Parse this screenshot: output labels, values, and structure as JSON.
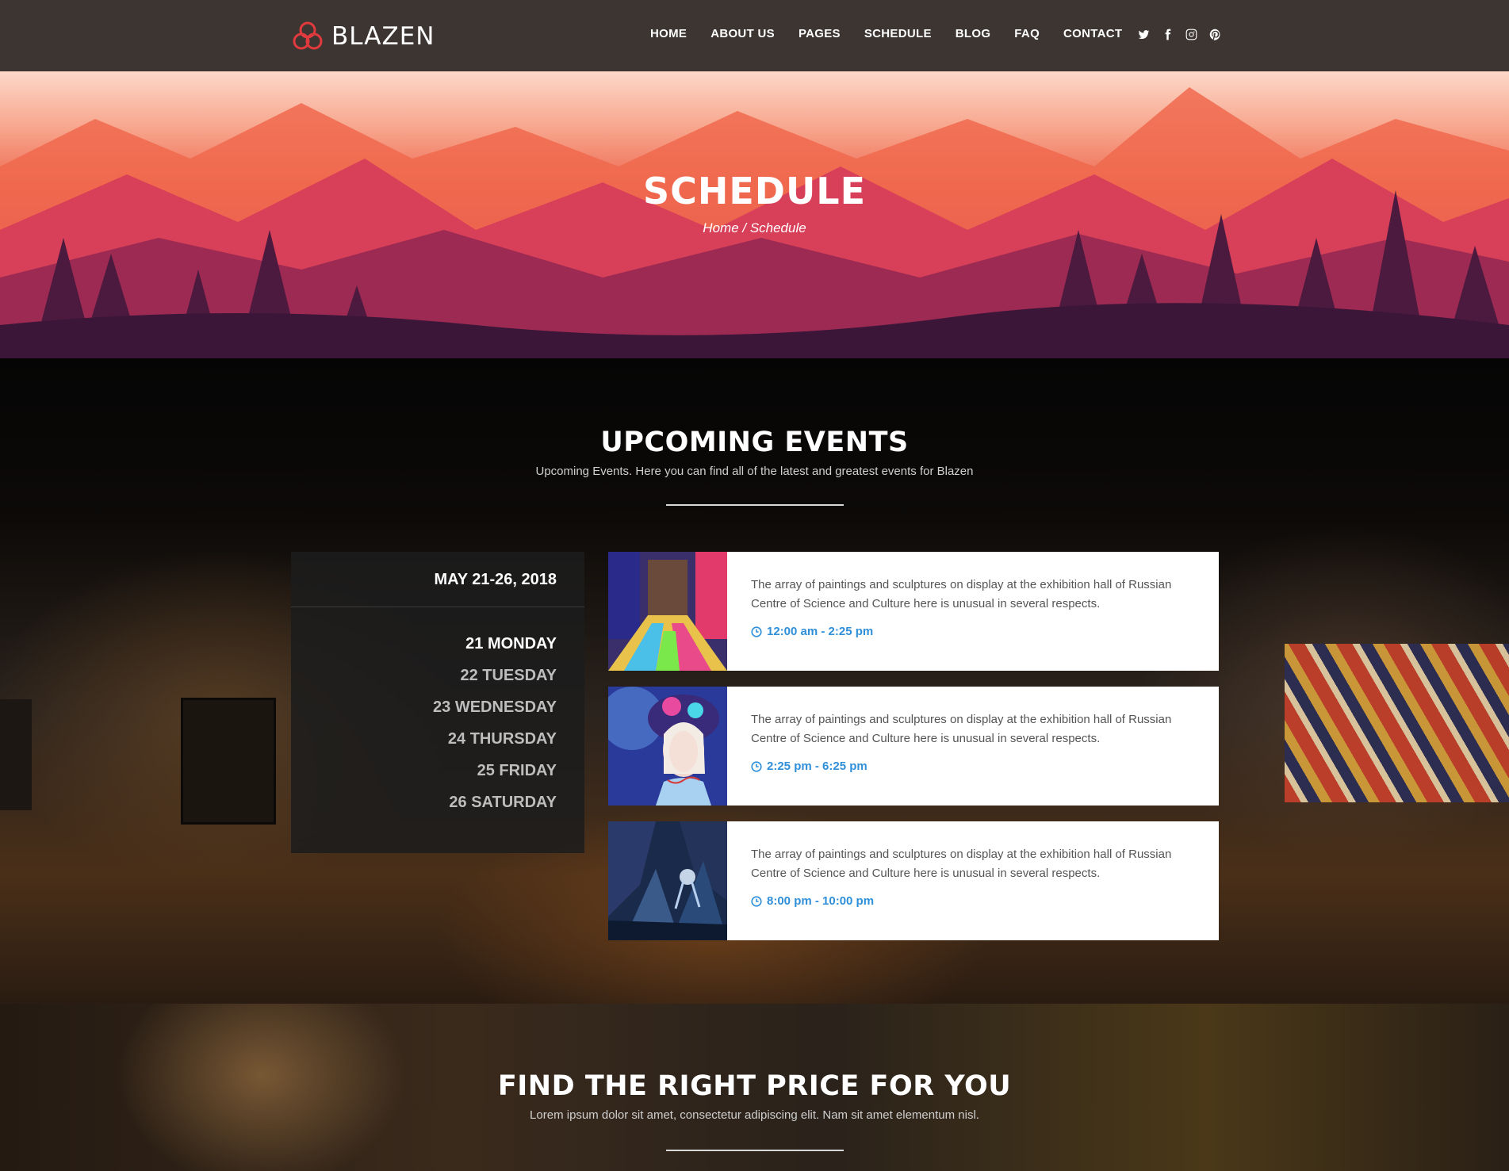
{
  "header": {
    "brand": "BLAZEN",
    "nav": [
      "HOME",
      "ABOUT US",
      "PAGES",
      "SCHEDULE",
      "BLOG",
      "FAQ",
      "CONTACT"
    ],
    "social_icons": [
      "twitter-icon",
      "facebook-icon",
      "instagram-icon",
      "pinterest-icon"
    ]
  },
  "hero": {
    "title": "SCHEDULE",
    "breadcrumb": "Home / Schedule"
  },
  "events_section": {
    "title": "UPCOMING EVENTS",
    "subtitle": "Upcoming Events. Here you can find all of the latest and greatest events for Blazen",
    "date_range": "MAY 21-26, 2018",
    "days": [
      "21 MONDAY",
      "22 TUESDAY",
      "23 WEDNESDAY",
      "24 THURSDAY",
      "25 FRIDAY",
      "26 SATURDAY"
    ],
    "active_day": "21 MONDAY",
    "events": [
      {
        "description": "The array of paintings and sculptures on display at the exhibition hall of Russian Centre of Science and Culture here is unusual in several respects.",
        "time": "12:00 am - 2:25 pm"
      },
      {
        "description": "The array of paintings and sculptures on display at the exhibition hall of Russian Centre of Science and Culture here is unusual in several respects.",
        "time": "2:25 pm - 6:25 pm"
      },
      {
        "description": "The array of paintings and sculptures on display at the exhibition hall of Russian Centre of Science and Culture here is unusual in several respects.",
        "time": "8:00 pm - 10:00 pm"
      }
    ]
  },
  "price_section": {
    "title": "FIND THE RIGHT PRICE FOR YOU",
    "subtitle": "Lorem ipsum dolor sit amet, consectetur adipiscing elit. Nam sit amet elementum nisl."
  },
  "colors": {
    "accent": "#e03a3e",
    "time_blue": "#2f8fd8",
    "header_bg": "#3c3532"
  }
}
